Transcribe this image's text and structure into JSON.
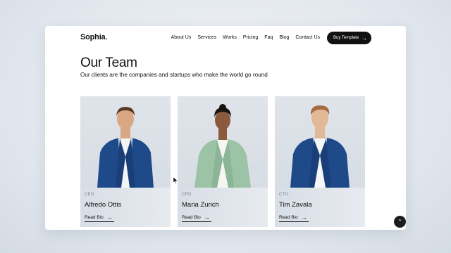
{
  "brand": {
    "name": "Sophia",
    "dot": "."
  },
  "nav": {
    "items": [
      "About Us",
      "Services",
      "Works",
      "Pricing",
      "Faq",
      "Blog",
      "Contact Us"
    ],
    "cta_label": "Buy Template",
    "cta_icon": "arrow-right-icon"
  },
  "hero": {
    "title": "Our Team",
    "subtitle": "Our clients are the companies and startups who make the world go round"
  },
  "team": [
    {
      "role": "CEO",
      "name": "Alfredo Ottis",
      "link": "Read Bio",
      "jacket": "#1f4a8a",
      "hair": "#5a3b26",
      "skin": "#d9a883"
    },
    {
      "role": "CFO",
      "name": "Maria Zurich",
      "link": "Read Bio",
      "jacket": "#9cc3a6",
      "hair": "#1a1410",
      "skin": "#8b5a3c"
    },
    {
      "role": "CTO",
      "name": "Tim Zavala",
      "link": "Read Bio",
      "jacket": "#1f4a8a",
      "hair": "#a36d3f",
      "skin": "#e2b896"
    }
  ],
  "colors": {
    "accent": "#1d4ed8",
    "dark": "#111111",
    "card_bg": "#e6eaef"
  }
}
